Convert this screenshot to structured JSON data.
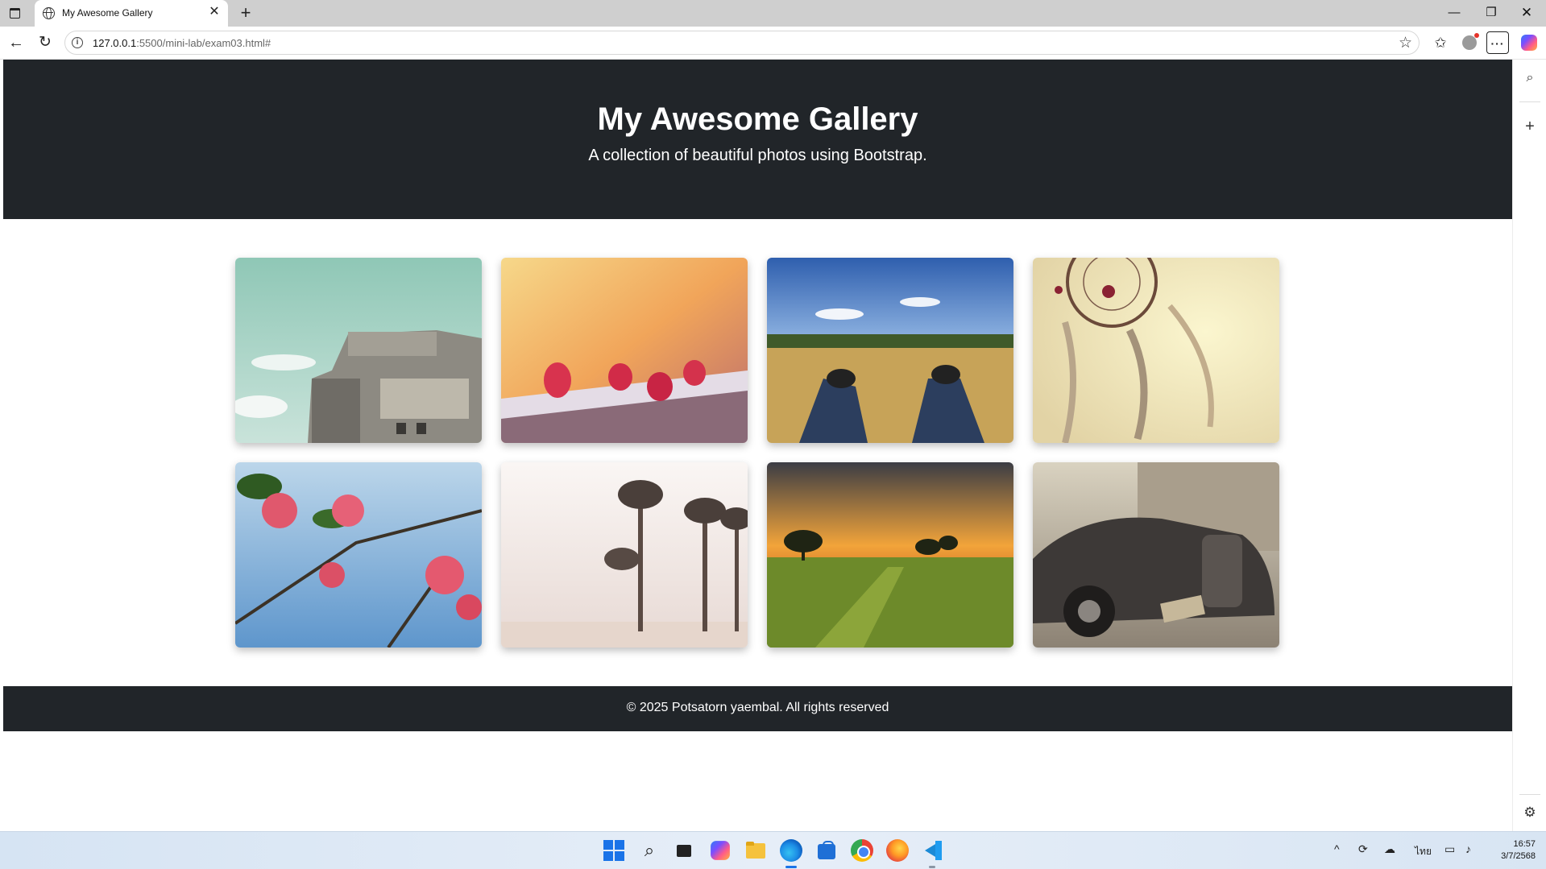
{
  "browser": {
    "tab_title": "My Awesome Gallery",
    "tab_close_glyph": "✕",
    "new_tab_glyph": "+",
    "window_controls": {
      "minimize": "—",
      "maximize": "❐",
      "close": "✕"
    },
    "url_host": "127.0.0.1",
    "url_path": ":5500/mini-lab/exam03.html#",
    "icons": [
      "tab-actions-icon",
      "globe-icon",
      "back-arrow-icon",
      "reload-icon",
      "info-icon",
      "star-icon",
      "favorites-icon",
      "profile-icon",
      "more-menu-icon",
      "copilot-icon"
    ],
    "menu_glyph": "···"
  },
  "sidebar": {
    "icons": [
      "search-icon",
      "add-icon",
      "settings-icon"
    ]
  },
  "page": {
    "hero": {
      "title": "My Awesome Gallery",
      "subtitle": "A collection of beautiful photos using Bootstrap."
    },
    "gallery": {
      "photos": [
        {
          "subject": "concrete-building-photo"
        },
        {
          "subject": "raspberries-photo"
        },
        {
          "subject": "sneakers-on-grass-photo"
        },
        {
          "subject": "dreamcatcher-photo"
        },
        {
          "subject": "pink-flowers-photo"
        },
        {
          "subject": "palm-trees-beach-photo"
        },
        {
          "subject": "sunset-field-photo"
        },
        {
          "subject": "vintage-car-photo"
        }
      ]
    },
    "footer": {
      "text": "© 2025 Potsatorn yaembal. All rights reserved"
    }
  },
  "taskbar": {
    "apps": [
      "windows-start-icon",
      "search-icon",
      "task-view-icon",
      "copilot-icon",
      "file-explorer-icon",
      "edge-icon",
      "store-icon",
      "chrome-icon",
      "firefox-icon",
      "vscode-icon"
    ],
    "tray": {
      "chevron": "^",
      "lang": "ไทย"
    },
    "clock": {
      "time": "16:57",
      "date": "3/7/2568"
    }
  },
  "colors": {
    "hero_bg": "#212529",
    "footer_bg": "#212529",
    "text_light": "#ffffff"
  }
}
